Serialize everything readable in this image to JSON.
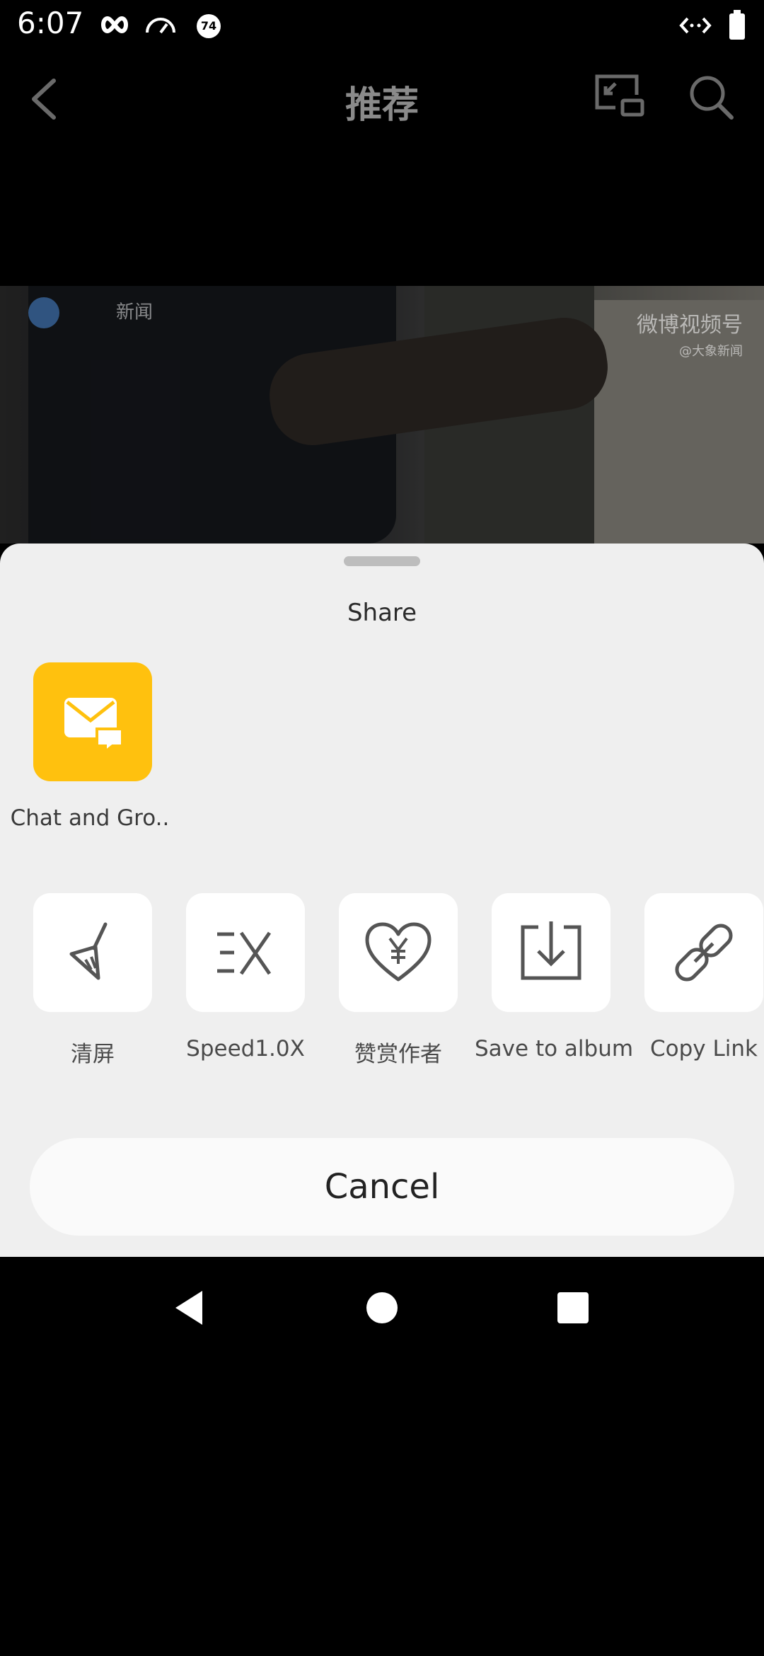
{
  "status_bar": {
    "time": "6:07",
    "badge": "74"
  },
  "header": {
    "title": "推荐"
  },
  "video": {
    "watermark_main": "微博视频号",
    "watermark_sub": "@大象新闻",
    "logo_text": "新闻"
  },
  "share_sheet": {
    "title": "Share",
    "apps": [
      {
        "label": "Chat and Gro..",
        "icon": "mail-chat-icon",
        "color": "#ffc10e"
      }
    ],
    "actions": [
      {
        "label": "清屏",
        "icon": "broom-icon"
      },
      {
        "label": "Speed1.0X",
        "icon": "speed-icon"
      },
      {
        "label": "赞赏作者",
        "icon": "heart-yen-icon"
      },
      {
        "label": "Save to album",
        "icon": "download-icon"
      },
      {
        "label": "Copy Link",
        "icon": "link-icon"
      }
    ],
    "cancel_label": "Cancel"
  }
}
